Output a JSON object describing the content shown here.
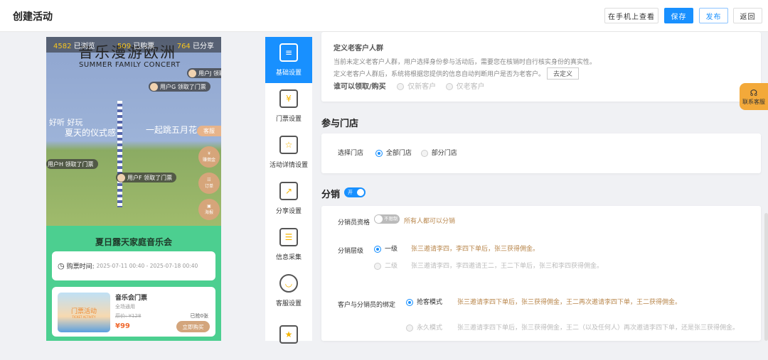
{
  "header": {
    "title": "创建活动",
    "view_on_phone": "在手机上查看",
    "save": "保存",
    "publish": "发布",
    "back": "返回"
  },
  "phone": {
    "stats": [
      {
        "num": "4582",
        "label": "已浏览"
      },
      {
        "num": "509",
        "label": "已购票"
      },
      {
        "num": "764",
        "label": "已分享"
      }
    ],
    "poster_title": "音乐漫游欧洲",
    "poster_subtitle": "SUMMER FAMILY CONCERT",
    "slogan_left_1": "好听 好玩",
    "slogan_left_2": "夏天的仪式感",
    "slogan_right": "一起跳五月花",
    "bubbles": [
      "用户J 领取了门票",
      "用户G 领取了门票",
      "用户H 领取了门票",
      "用户F 领取了门票"
    ],
    "kefu": "客服",
    "side_buttons": [
      "赚佣金",
      "订单",
      "海报"
    ],
    "event_title": "夏日露天家庭音乐会",
    "time_label": "购票时间:",
    "time_value": "2025-07-11 00:40 - 2025-07-18 00:40",
    "ticket": {
      "name": "音乐会门票",
      "scope": "全场通用",
      "orig_price": "原价: ¥128",
      "sold": "已抢0张",
      "price": "¥99",
      "buy": "立即购买",
      "image_text": "门票活动",
      "image_sub": "TICKET ACTIVITY"
    }
  },
  "sidebar": {
    "items": [
      {
        "label": "基础设置",
        "icon": "document-icon"
      },
      {
        "label": "门票设置",
        "icon": "ticket-icon"
      },
      {
        "label": "活动详情设置",
        "icon": "detail-icon"
      },
      {
        "label": "分享设置",
        "icon": "share-icon"
      },
      {
        "label": "信息采集",
        "icon": "form-icon"
      },
      {
        "label": "客服设置",
        "icon": "headset-icon"
      },
      {
        "label": "",
        "icon": "flag-icon"
      }
    ]
  },
  "old_customer": {
    "title": "定义老客户人群",
    "desc1": "当前未定义老客户人群，用户选择身份参与活动后，需要您在核销时自行核实身份的真实性。",
    "desc2": "定义老客户人群后，系统将根据您提供的信息自动判断用户是否为老客户。",
    "define_btn": "去定义",
    "who_label": "谁可以领取/购买",
    "options": [
      "仅新客户",
      "仅老客户"
    ]
  },
  "stores": {
    "title": "参与门店",
    "label": "选择门店",
    "options": [
      "全部门店",
      "部分门店"
    ],
    "selected": "全部门店"
  },
  "distribution": {
    "title": "分销",
    "toggle": "开",
    "enabled": true,
    "qual_label": "分销员资格",
    "qual_toggle": "不限制",
    "qual_desc": "所有人都可以分销",
    "level_label": "分销层级",
    "levels": [
      {
        "name": "一级",
        "desc": "张三邀请李四，李四下单后，张三获得佣金。",
        "selected": true
      },
      {
        "name": "二级",
        "desc": "张三邀请李四，李四邀请王二，王二下单后，张三和李四获得佣金。",
        "selected": false
      }
    ],
    "bind_label": "客户与分销员的绑定",
    "binds": [
      {
        "name": "抢客模式",
        "desc": "张三邀请李四下单后，张三获得佣金，王二再次邀请李四下单，王二获得佣金。",
        "selected": true
      },
      {
        "name": "永久模式",
        "desc": "张三邀请李四下单后，张三获得佣金，王二（以及任何人）再次邀请李四下单，还是张三获得佣金。",
        "selected": false
      }
    ]
  },
  "float_service": "联系客服",
  "colors": {
    "primary": "#1890ff",
    "gold": "#b8864b",
    "green": "#4ccf90",
    "orange": "#f3a93a"
  }
}
